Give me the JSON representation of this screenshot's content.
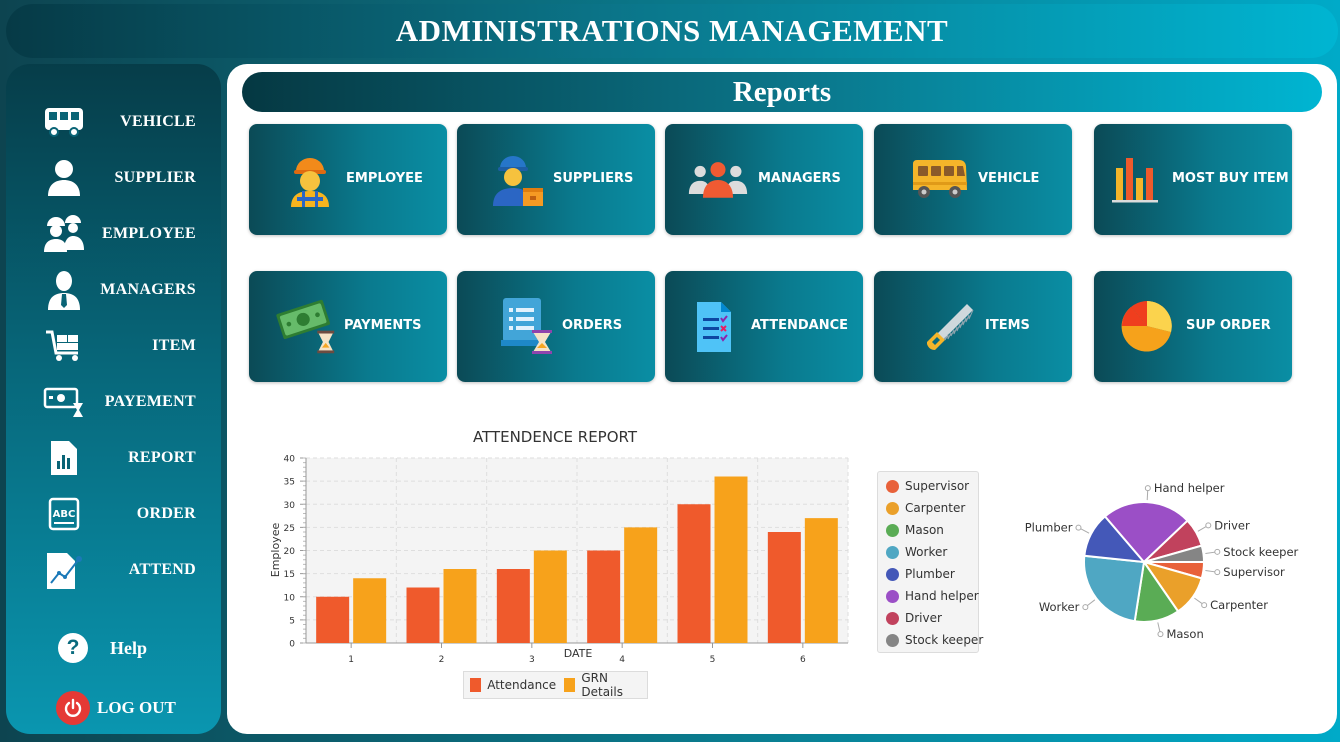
{
  "app": {
    "title": "ADMINISTRATIONS MANAGEMENT"
  },
  "sidebar": {
    "items": [
      {
        "label": "VEHICLE",
        "icon": "bus-icon"
      },
      {
        "label": "SUPPLIER",
        "icon": "user-icon"
      },
      {
        "label": "EMPLOYEE",
        "icon": "workers-icon"
      },
      {
        "label": "MANAGERS",
        "icon": "manager-icon"
      },
      {
        "label": "ITEM",
        "icon": "cart-icon"
      },
      {
        "label": "PAYEMENT",
        "icon": "payment-icon"
      },
      {
        "label": "REPORT",
        "icon": "report-icon"
      },
      {
        "label": "ORDER",
        "icon": "abc-book-icon"
      },
      {
        "label": "ATTEND",
        "icon": "graph-doc-icon"
      }
    ],
    "help_label": "Help",
    "help_glyph": "?",
    "logout_label": "LOG OUT"
  },
  "main": {
    "title": "Reports",
    "tiles_row1": [
      {
        "label": "EMPLOYEE",
        "icon": "worker-icon"
      },
      {
        "label": "SUPPLIERS",
        "icon": "supplier-icon"
      },
      {
        "label": "MANAGERS",
        "icon": "people-group-icon"
      },
      {
        "label": "VEHICLE",
        "icon": "van-icon"
      },
      {
        "label": "MOST BUY ITEM",
        "icon": "bar-chart-icon"
      }
    ],
    "tiles_row2": [
      {
        "label": "PAYMENTS",
        "icon": "money-icon"
      },
      {
        "label": "ORDERS",
        "icon": "order-list-icon"
      },
      {
        "label": "ATTENDANCE",
        "icon": "checklist-icon"
      },
      {
        "label": "ITEMS",
        "icon": "saw-icon"
      },
      {
        "label": "SUP ORDER",
        "icon": "pie-chart-icon"
      }
    ]
  },
  "colors": {
    "attendance": "#ef5a2c",
    "grn": "#f7a21b"
  },
  "chart_data": [
    {
      "type": "bar",
      "title": "ATTENDENCE REPORT",
      "xlabel": "DATE",
      "ylabel": "Employee",
      "categories": [
        "1",
        "2",
        "3",
        "4",
        "5",
        "6"
      ],
      "ylim": [
        0,
        40
      ],
      "yticks": [
        0,
        5,
        10,
        15,
        20,
        25,
        30,
        35,
        40
      ],
      "grid": true,
      "legend": "bottom",
      "series": [
        {
          "name": "Attendance",
          "color": "#ef5a2c",
          "values": [
            10,
            12,
            16,
            20,
            30,
            24
          ]
        },
        {
          "name": "GRN Details",
          "color": "#f7a21b",
          "values": [
            14,
            16,
            20,
            25,
            36,
            27
          ]
        }
      ]
    },
    {
      "type": "pie",
      "legend": "left",
      "slices": [
        {
          "label": "Supervisor",
          "value": 4,
          "color": "#e8613a"
        },
        {
          "label": "Carpenter",
          "value": 10,
          "color": "#eaa02a"
        },
        {
          "label": "Mason",
          "value": 11,
          "color": "#5aac55"
        },
        {
          "label": "Worker",
          "value": 22,
          "color": "#4fa7c3"
        },
        {
          "label": "Plumber",
          "value": 11,
          "color": "#4458b8"
        },
        {
          "label": "Hand helper",
          "value": 22,
          "color": "#9b4fc6"
        },
        {
          "label": "Driver",
          "value": 7,
          "color": "#c1425d"
        },
        {
          "label": "Stock keeper",
          "value": 4,
          "color": "#858585"
        }
      ]
    }
  ]
}
